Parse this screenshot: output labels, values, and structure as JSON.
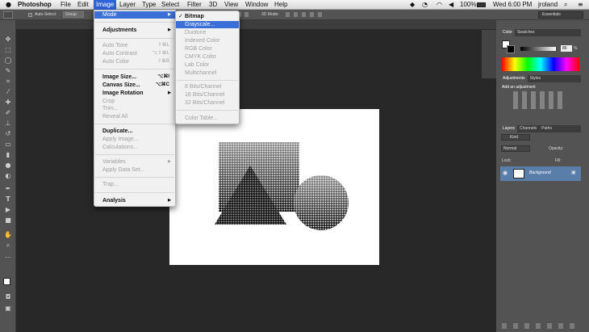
{
  "menubar": {
    "apple": "",
    "app": "Photoshop",
    "items": [
      "File",
      "Edit",
      "Image",
      "Layer",
      "Type",
      "Select",
      "Filter",
      "3D",
      "View",
      "Window",
      "Help"
    ],
    "selected": "Image",
    "right": {
      "battery": "100%",
      "clock": "Wed 6:00 PM",
      "user": "jroland"
    }
  },
  "options": {
    "auto_select": "Auto-Select:",
    "group": "Group",
    "mode3d": "3D Mode:",
    "workspace": "Essentials"
  },
  "image_menu": {
    "items": [
      {
        "label": "Mode",
        "shortcut": "",
        "state": "highlight",
        "arrow": true
      },
      {
        "label": "Adjustments",
        "shortcut": "",
        "state": "bold",
        "arrow": true
      },
      {
        "label": "Auto Tone",
        "shortcut": "⇧⌘L",
        "state": "disabled"
      },
      {
        "label": "Auto Contrast",
        "shortcut": "⌥⇧⌘L",
        "state": "disabled"
      },
      {
        "label": "Auto Color",
        "shortcut": "⇧⌘B",
        "state": "disabled"
      },
      {
        "label": "Image Size...",
        "shortcut": "⌥⌘I",
        "state": "bold"
      },
      {
        "label": "Canvas Size...",
        "shortcut": "⌥⌘C",
        "state": "bold"
      },
      {
        "label": "Image Rotation",
        "shortcut": "",
        "state": "bold",
        "arrow": true
      },
      {
        "label": "Crop",
        "shortcut": "",
        "state": "disabled"
      },
      {
        "label": "Trim...",
        "shortcut": "",
        "state": "disabled"
      },
      {
        "label": "Reveal All",
        "shortcut": "",
        "state": "disabled"
      },
      {
        "label": "Duplicate...",
        "shortcut": "",
        "state": "bold"
      },
      {
        "label": "Apply Image...",
        "shortcut": "",
        "state": "disabled"
      },
      {
        "label": "Calculations...",
        "shortcut": "",
        "state": "disabled"
      },
      {
        "label": "Variables",
        "shortcut": "",
        "state": "disabled",
        "arrow": true
      },
      {
        "label": "Apply Data Set...",
        "shortcut": "",
        "state": "disabled"
      },
      {
        "label": "Trap...",
        "shortcut": "",
        "state": "disabled"
      },
      {
        "label": "Analysis",
        "shortcut": "",
        "state": "bold",
        "arrow": true
      }
    ]
  },
  "mode_menu": {
    "items": [
      {
        "label": "Bitmap",
        "check": "✓",
        "state": "bold"
      },
      {
        "label": "Grayscale...",
        "state": "highlight"
      },
      {
        "label": "Duotone",
        "state": "disabled"
      },
      {
        "label": "Indexed Color",
        "state": "disabled"
      },
      {
        "label": "RGB Color",
        "state": "disabled"
      },
      {
        "label": "CMYK Color",
        "state": "disabled"
      },
      {
        "label": "Lab Color",
        "state": "disabled"
      },
      {
        "label": "Multichannel",
        "state": "disabled"
      },
      {
        "label": "8 Bits/Channel",
        "state": "disabled"
      },
      {
        "label": "16 Bits/Channel",
        "state": "disabled"
      },
      {
        "label": "32 Bits/Channel",
        "state": "disabled"
      },
      {
        "label": "Color Table...",
        "state": "disabled"
      }
    ]
  },
  "panels": {
    "color_tabs": [
      "Color",
      "Swatches"
    ],
    "color_value": "86",
    "color_unit": "%",
    "adjust_tabs": [
      "Adjustments",
      "Styles"
    ],
    "adjust_title": "Add an adjustment",
    "layers_tabs": [
      "Layers",
      "Channels",
      "Paths"
    ],
    "kind": "Kind",
    "blend": "Normal",
    "opacity": "Opacity:",
    "lock": "Lock:",
    "fill": "Fill:",
    "layer_name": "Background"
  },
  "colors": {
    "accent": "#3a6fd8",
    "layer_selected": "#5a7eaa",
    "canvas": "#282828",
    "panel": "#535353"
  }
}
